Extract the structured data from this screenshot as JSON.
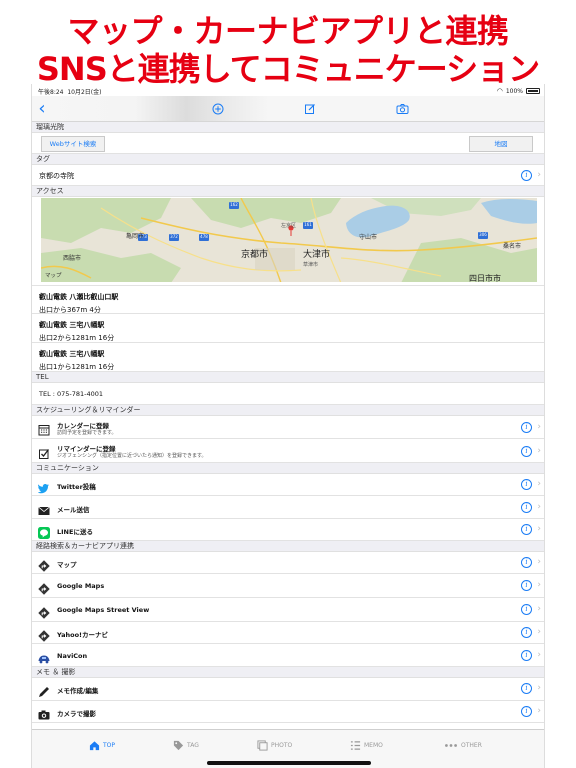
{
  "promo": {
    "line1": "マップ・カーナビアプリと連携",
    "line2": "SNSと連携してコミュニケーション"
  },
  "status": {
    "time": "午後8:24",
    "date": "10月2日(金)",
    "battery": "100%"
  },
  "place": {
    "name": "瑠璃光院",
    "web_button": "Webサイト検索",
    "map_button": "地図"
  },
  "sections": {
    "tag": "タグ",
    "access": "アクセス",
    "tel": "TEL",
    "schedule": "スケジューリング＆リマインダー",
    "communication": "コミュニケーション",
    "route": "経路検索＆カーナビアプリ連携",
    "memo": "メモ ＆ 撮影"
  },
  "tag_value": "京都の寺院",
  "map": {
    "attribution": "マップ",
    "labels": [
      "亀岡市",
      "京都市",
      "大津市",
      "西脇市",
      "篠山市",
      "四日市市",
      "桑名市",
      "守山市",
      "草津市",
      "左京区",
      "甲賀市"
    ],
    "route_shields": [
      "162",
      "161",
      "173",
      "372",
      "478",
      "1",
      "306"
    ]
  },
  "stations": [
    {
      "name": "叡山電鉄 八瀬比叡山口駅",
      "detail": "出口から367m 4分"
    },
    {
      "name": "叡山電鉄 三宅八幡駅",
      "detail": "出口2から1281m 16分"
    },
    {
      "name": "叡山電鉄 三宅八幡駅",
      "detail": "出口1から1281m 16分"
    }
  ],
  "tel_value": "TEL : 075-781-4001",
  "schedule_items": [
    {
      "title": "カレンダーに登録",
      "sub": "訪問予定を登録できます。",
      "icon": "calendar-icon"
    },
    {
      "title": "リマインダーに登録",
      "sub": "ジオフェンシング（指定位置に近づいたら通知）を登録できます。",
      "icon": "reminder-check-icon"
    }
  ],
  "communication_items": [
    {
      "title": "Twitter投稿",
      "icon": "twitter-icon"
    },
    {
      "title": "メール送信",
      "icon": "mail-icon"
    },
    {
      "title": "LINEに送る",
      "icon": "line-icon"
    }
  ],
  "route_items": [
    {
      "title": "マップ",
      "icon": "route-sign-icon"
    },
    {
      "title": "Google Maps",
      "icon": "route-sign-icon"
    },
    {
      "title": "Google Maps Street View",
      "icon": "route-sign-icon"
    },
    {
      "title": "Yahoo!カーナビ",
      "icon": "route-sign-icon"
    },
    {
      "title": "NaviCon",
      "icon": "navicon-icon"
    }
  ],
  "memo_items": [
    {
      "title": "メモ作成/編集",
      "icon": "pen-icon"
    },
    {
      "title": "カメラで撮影",
      "icon": "camera-icon"
    }
  ],
  "tabs": [
    {
      "label": "TOP",
      "icon": "home-icon",
      "active": true
    },
    {
      "label": "TAG",
      "icon": "tag-icon",
      "active": false
    },
    {
      "label": "PHOTO",
      "icon": "photo-icon",
      "active": false
    },
    {
      "label": "MEMO",
      "icon": "list-icon",
      "active": false
    },
    {
      "label": "OTHER",
      "icon": "more-dots-icon",
      "active": false
    }
  ],
  "colors": {
    "promo_red": "#e60012",
    "accent_blue": "#1a7cf5",
    "section_bg": "#efeff4"
  }
}
